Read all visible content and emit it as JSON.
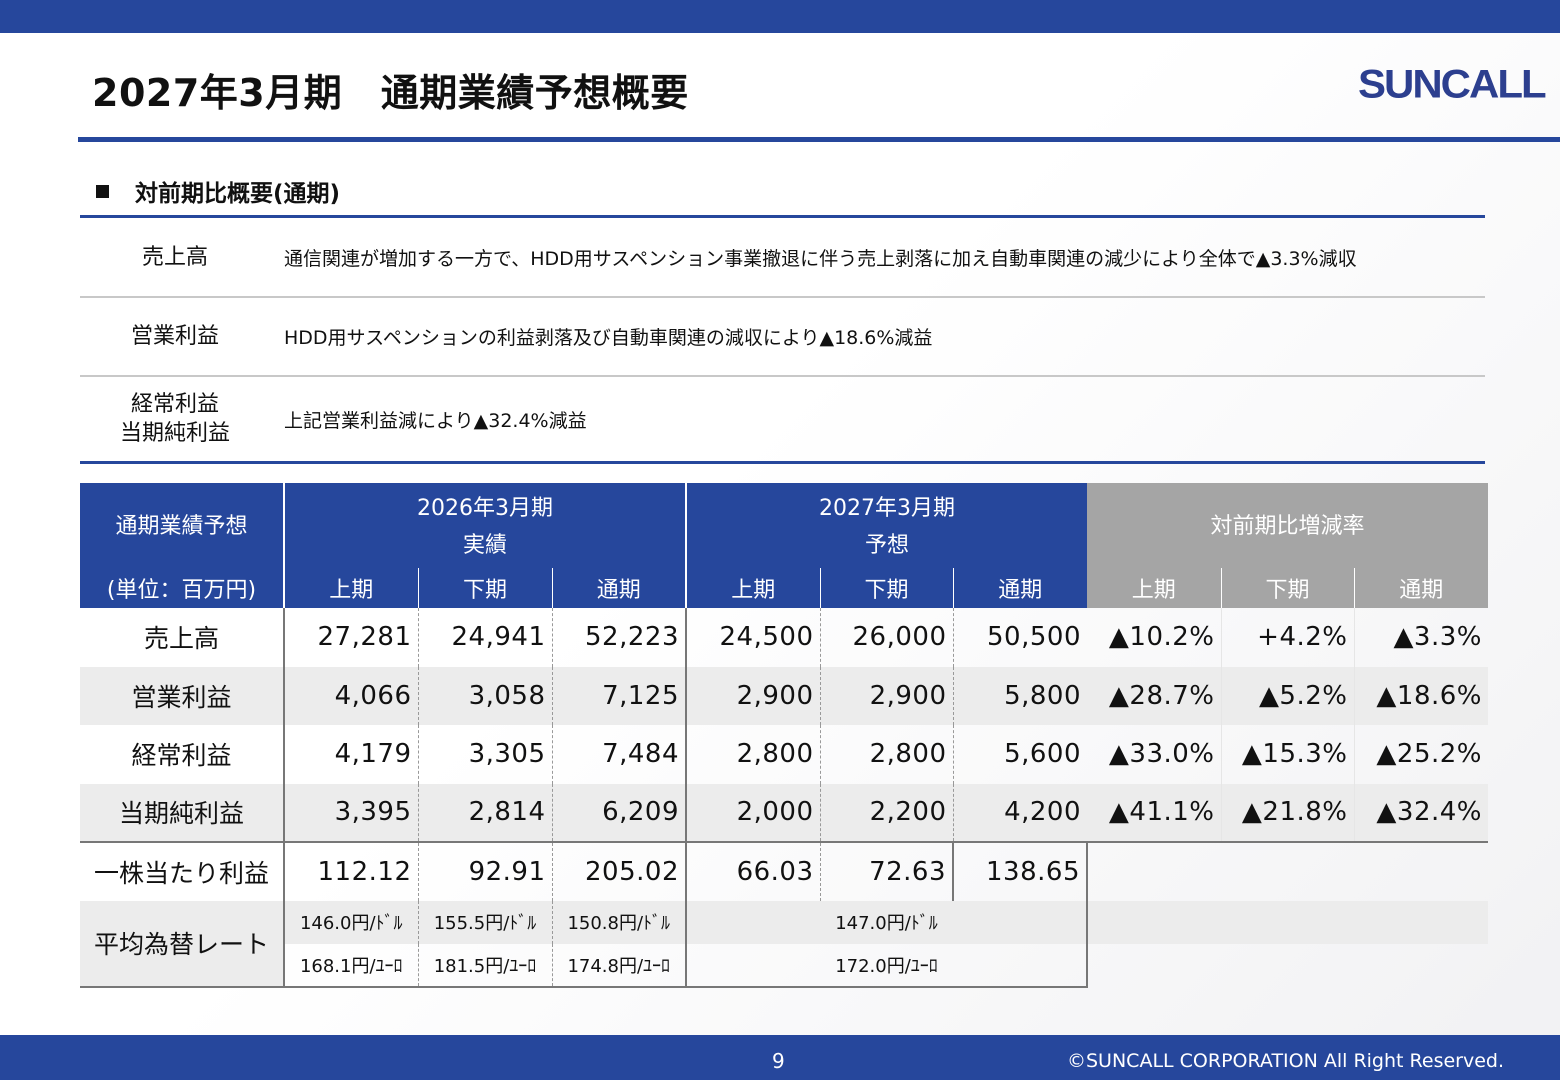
{
  "title": "2027年3月期　通期業績予想概要",
  "logo": "SUNCALL",
  "section_heading": "対前期比概要(通期)",
  "summary": [
    {
      "label_lines": [
        "売上高"
      ],
      "text": "通信関連が増加する一方で、HDD用サスペンション事業撤退に伴う売上剥落に加え自動車関連の減少により全体で▲3.3%減収"
    },
    {
      "label_lines": [
        "営業利益"
      ],
      "text": "HDD用サスペンションの利益剥落及び自動車関連の減収により▲18.6%減益"
    },
    {
      "label_lines": [
        "経常利益",
        "当期純利益"
      ],
      "text": "上記営業利益減により▲32.4%減益"
    }
  ],
  "table": {
    "corner_title": "通期業績予想",
    "corner_unit": "(単位：百万円)",
    "group_2026_year": "2026年3月期",
    "group_2026_type": "実績",
    "group_2027_year": "2027年3月期",
    "group_2027_type": "予想",
    "group_change": "対前期比増減率",
    "sub_headers": [
      "上期",
      "下期",
      "通期",
      "上期",
      "下期",
      "通期",
      "上期",
      "下期",
      "通期"
    ],
    "rows": [
      {
        "label": "売上高",
        "values": [
          "27,281",
          "24,941",
          "52,223",
          "24,500",
          "26,000",
          "50,500",
          "▲10.2%",
          "+4.2%",
          "▲3.3%"
        ]
      },
      {
        "label": "営業利益",
        "values": [
          "4,066",
          "3,058",
          "7,125",
          "2,900",
          "2,900",
          "5,800",
          "▲28.7%",
          "▲5.2%",
          "▲18.6%"
        ]
      },
      {
        "label": "経常利益",
        "values": [
          "4,179",
          "3,305",
          "7,484",
          "2,800",
          "2,800",
          "5,600",
          "▲33.0%",
          "▲15.3%",
          "▲25.2%"
        ]
      },
      {
        "label": "当期純利益",
        "values": [
          "3,395",
          "2,814",
          "6,209",
          "2,000",
          "2,200",
          "4,200",
          "▲41.1%",
          "▲21.8%",
          "▲32.4%"
        ]
      }
    ],
    "eps": {
      "label": "一株当たり利益",
      "values": [
        "112.12",
        "92.91",
        "205.02",
        "66.03",
        "72.63",
        "138.65"
      ]
    },
    "fx": {
      "label": "平均為替レート",
      "usd": [
        "146.0円/ﾄﾞﾙ",
        "155.5円/ﾄﾞﾙ",
        "150.8円/ﾄﾞﾙ",
        "147.0円/ﾄﾞﾙ"
      ],
      "eur": [
        "168.1円/ﾕｰﾛ",
        "181.5円/ﾕｰﾛ",
        "174.8円/ﾕｰﾛ",
        "172.0円/ﾕｰﾛ"
      ]
    }
  },
  "footer": {
    "page_number": "9",
    "copyright": "©SUNCALL CORPORATION All Right Reserved."
  },
  "colors": {
    "brand_blue": "#26479c",
    "header_grey": "#a5a5a5",
    "row_shade": "#ececec"
  }
}
